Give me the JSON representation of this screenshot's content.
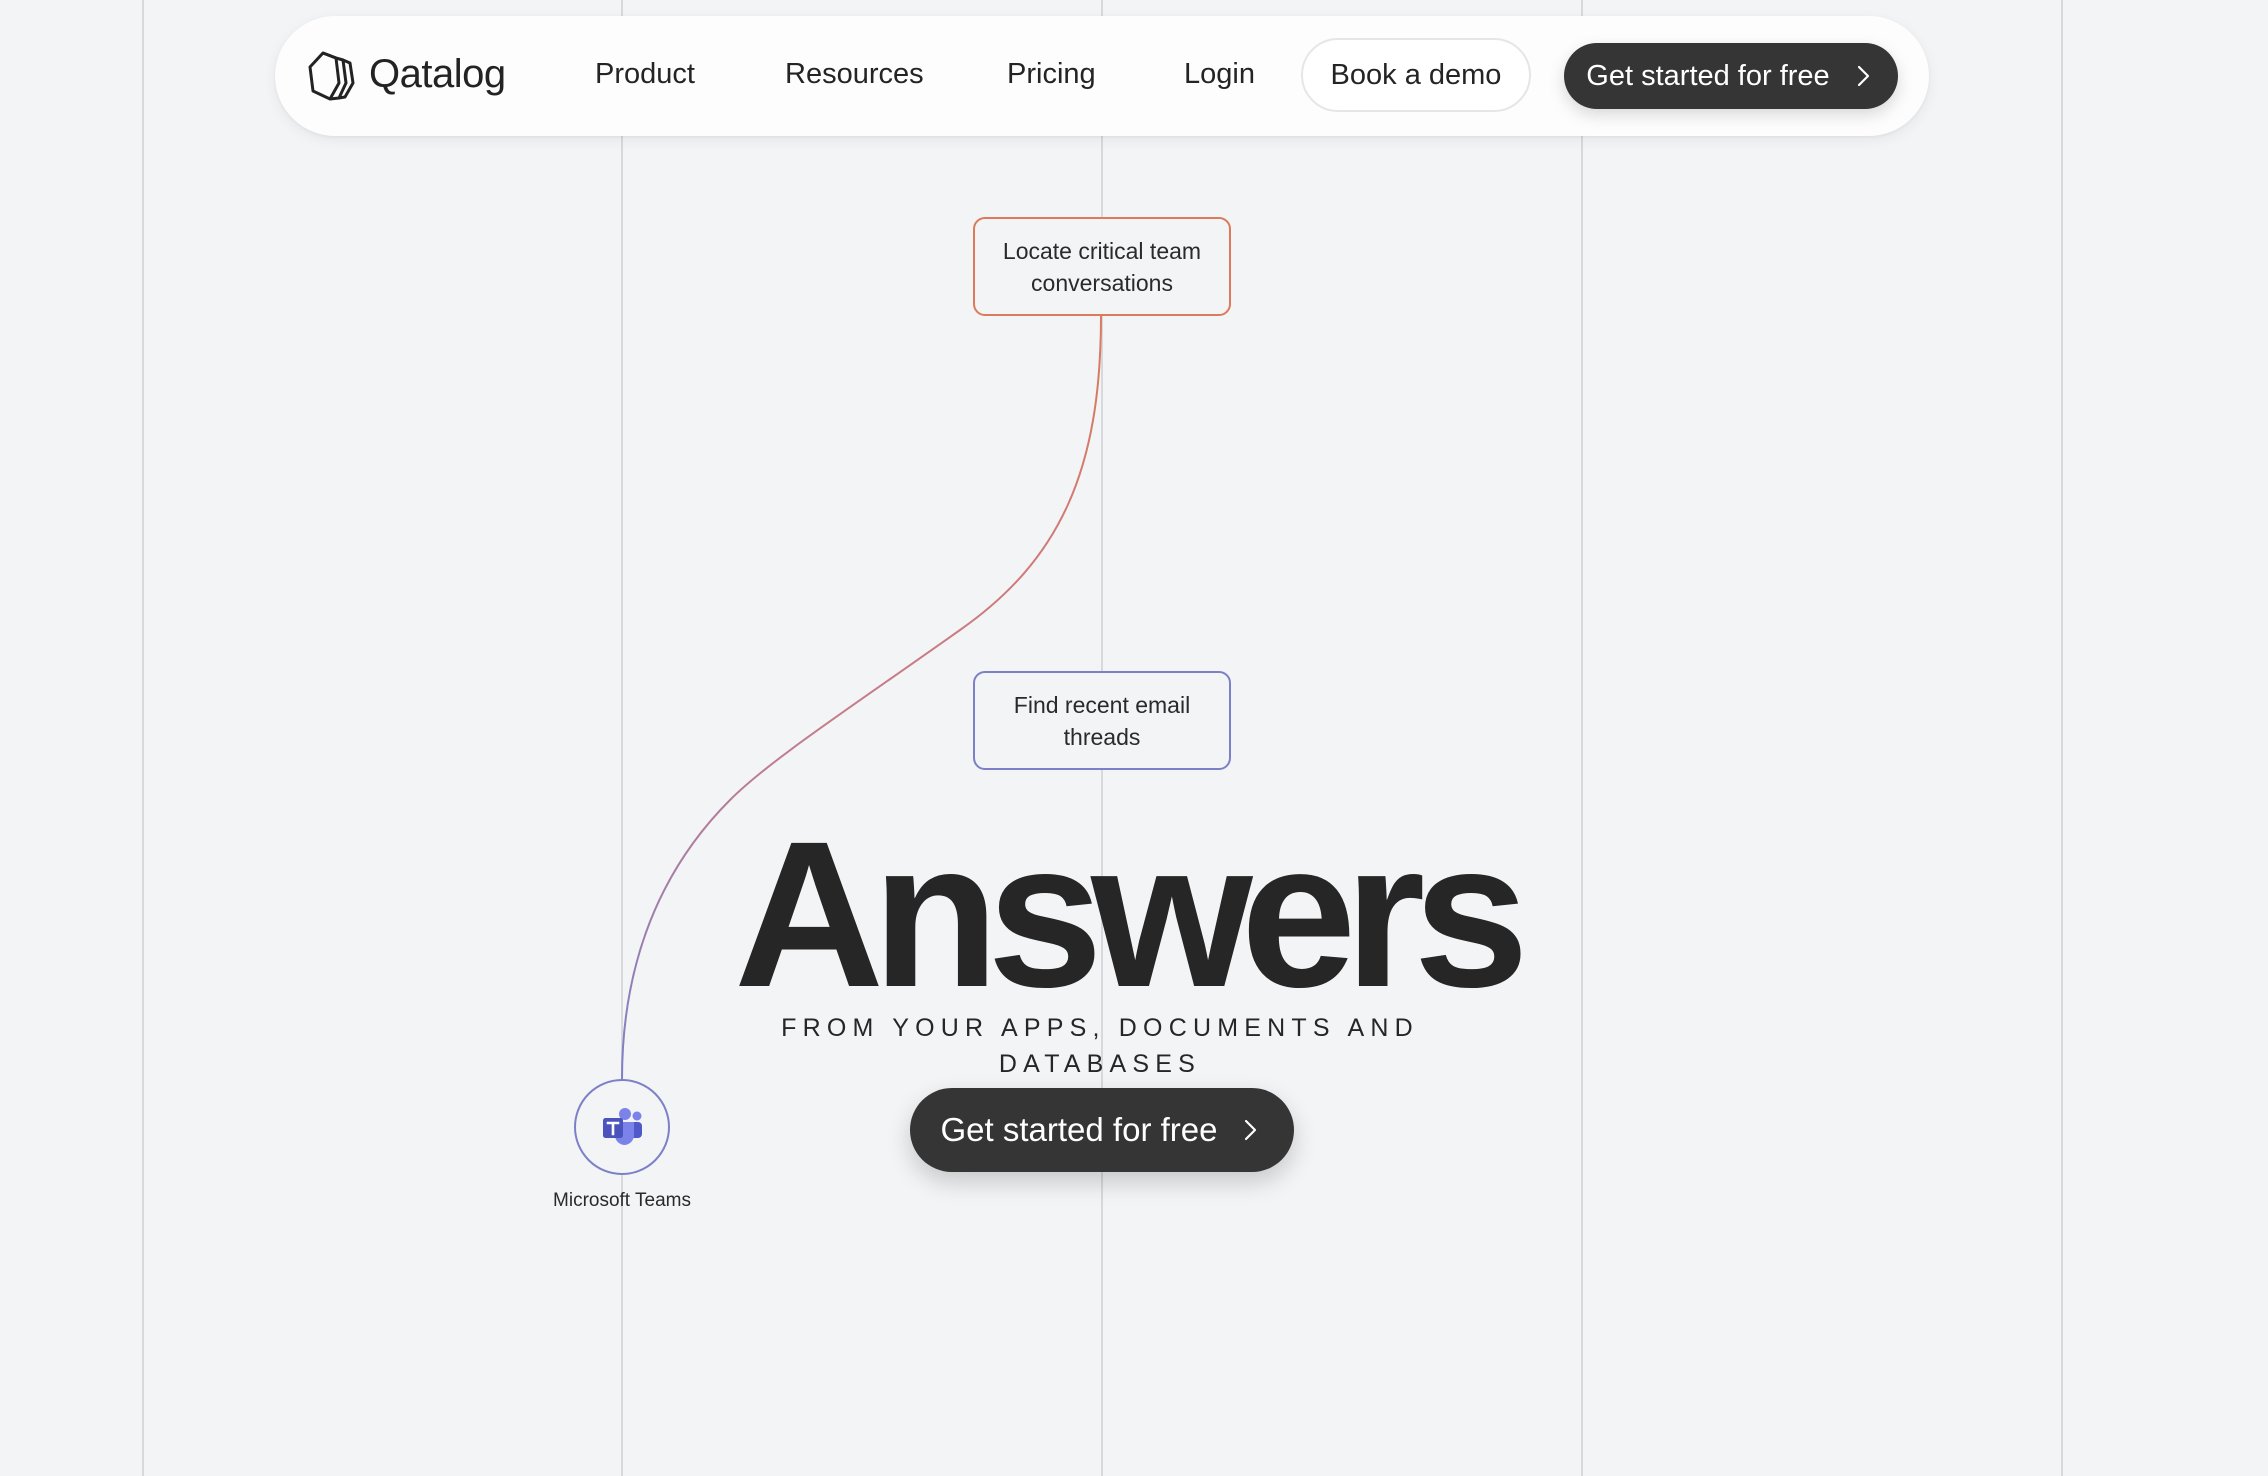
{
  "nav": {
    "brand": "Qatalog",
    "logo_icon": "qatalog-hexagon-logo",
    "items": [
      {
        "label": "Product"
      },
      {
        "label": "Resources"
      },
      {
        "label": "Pricing"
      },
      {
        "label": "Login"
      }
    ],
    "book_demo_label": "Book a demo",
    "cta_label": "Get started for free",
    "cta_icon": "chevron-right-icon"
  },
  "flow": {
    "tasks": [
      {
        "label": "Locate critical team conversations",
        "accent": "#dc7a5b"
      },
      {
        "label": "Find recent email threads",
        "accent": "#7d80c6"
      }
    ],
    "app": {
      "label": "Microsoft Teams",
      "icon": "microsoft-teams-icon",
      "accent": "#7d80c6"
    }
  },
  "hero": {
    "headline": "Answers",
    "subheadline": "FROM YOUR APPS, DOCUMENTS AND DATABASES",
    "cta_label": "Get started for free",
    "cta_icon": "chevron-right-icon"
  },
  "colors": {
    "background": "#f3f4f6",
    "dark_button": "#353535",
    "orange_accent": "#dc7a5b",
    "purple_accent": "#7d80c6",
    "grid_line": "#d8d9dc"
  }
}
